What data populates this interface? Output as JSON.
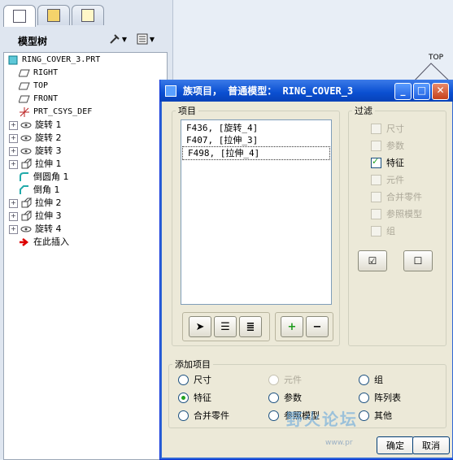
{
  "left_panel": {
    "tree_title": "模型树",
    "tree": [
      {
        "label": "RING_COVER_3.PRT",
        "icon": "part-icon",
        "expander": ""
      },
      {
        "label": "RIGHT",
        "icon": "datum-plane-icon",
        "expander": ""
      },
      {
        "label": "TOP",
        "icon": "datum-plane-icon",
        "expander": ""
      },
      {
        "label": "FRONT",
        "icon": "datum-plane-icon",
        "expander": ""
      },
      {
        "label": "PRT_CSYS_DEF",
        "icon": "csys-icon",
        "expander": ""
      },
      {
        "label": "旋转 1",
        "icon": "revolve-icon",
        "expander": "+"
      },
      {
        "label": "旋转 2",
        "icon": "revolve-icon",
        "expander": "+"
      },
      {
        "label": "旋转 3",
        "icon": "revolve-icon",
        "expander": "+"
      },
      {
        "label": "拉伸 1",
        "icon": "extrude-icon",
        "expander": "+"
      },
      {
        "label": "倒圆角 1",
        "icon": "round-icon",
        "expander": ""
      },
      {
        "label": "倒角 1",
        "icon": "chamfer-icon",
        "expander": ""
      },
      {
        "label": "拉伸 2",
        "icon": "extrude-icon",
        "expander": "+"
      },
      {
        "label": "拉伸 3",
        "icon": "extrude-icon",
        "expander": "+"
      },
      {
        "label": "旋转 4",
        "icon": "revolve-icon",
        "expander": "+"
      },
      {
        "label": "在此插入",
        "icon": "insert-here-arrow-icon",
        "expander": ""
      }
    ]
  },
  "background": {
    "top_label": "TOP"
  },
  "dialog": {
    "title": "族项目， 普通模型： RING_COVER_3",
    "items_legend": "项目",
    "items": [
      "F436, [旋转_4]",
      "F407, [拉伸_3]",
      "F498, [拉伸_4]"
    ],
    "filter_legend": "过滤",
    "filters": [
      {
        "label": "尺寸",
        "checked": false,
        "enabled": false
      },
      {
        "label": "参数",
        "checked": false,
        "enabled": false
      },
      {
        "label": "特征",
        "checked": true,
        "enabled": true
      },
      {
        "label": "元件",
        "checked": false,
        "enabled": false
      },
      {
        "label": "合并零件",
        "checked": false,
        "enabled": false
      },
      {
        "label": "参照模型",
        "checked": false,
        "enabled": false
      },
      {
        "label": "组",
        "checked": false,
        "enabled": false
      }
    ],
    "add_legend": "添加项目",
    "add_options": [
      {
        "label": "尺寸",
        "selected": false,
        "enabled": true
      },
      {
        "label": "元件",
        "selected": false,
        "enabled": false
      },
      {
        "label": "组",
        "selected": false,
        "enabled": true
      },
      {
        "label": "特征",
        "selected": true,
        "enabled": true
      },
      {
        "label": "参数",
        "selected": false,
        "enabled": true
      },
      {
        "label": "阵列表",
        "selected": false,
        "enabled": true
      },
      {
        "label": "合并零件",
        "selected": false,
        "enabled": true
      },
      {
        "label": "参照模型",
        "selected": false,
        "enabled": true
      },
      {
        "label": "其他",
        "selected": false,
        "enabled": true
      }
    ],
    "ok_label": "确定",
    "cancel_label": "取消",
    "add_symbol": "+",
    "remove_symbol": "−"
  },
  "watermark": {
    "text": "野火论坛",
    "url_fragment": "www.pr"
  }
}
